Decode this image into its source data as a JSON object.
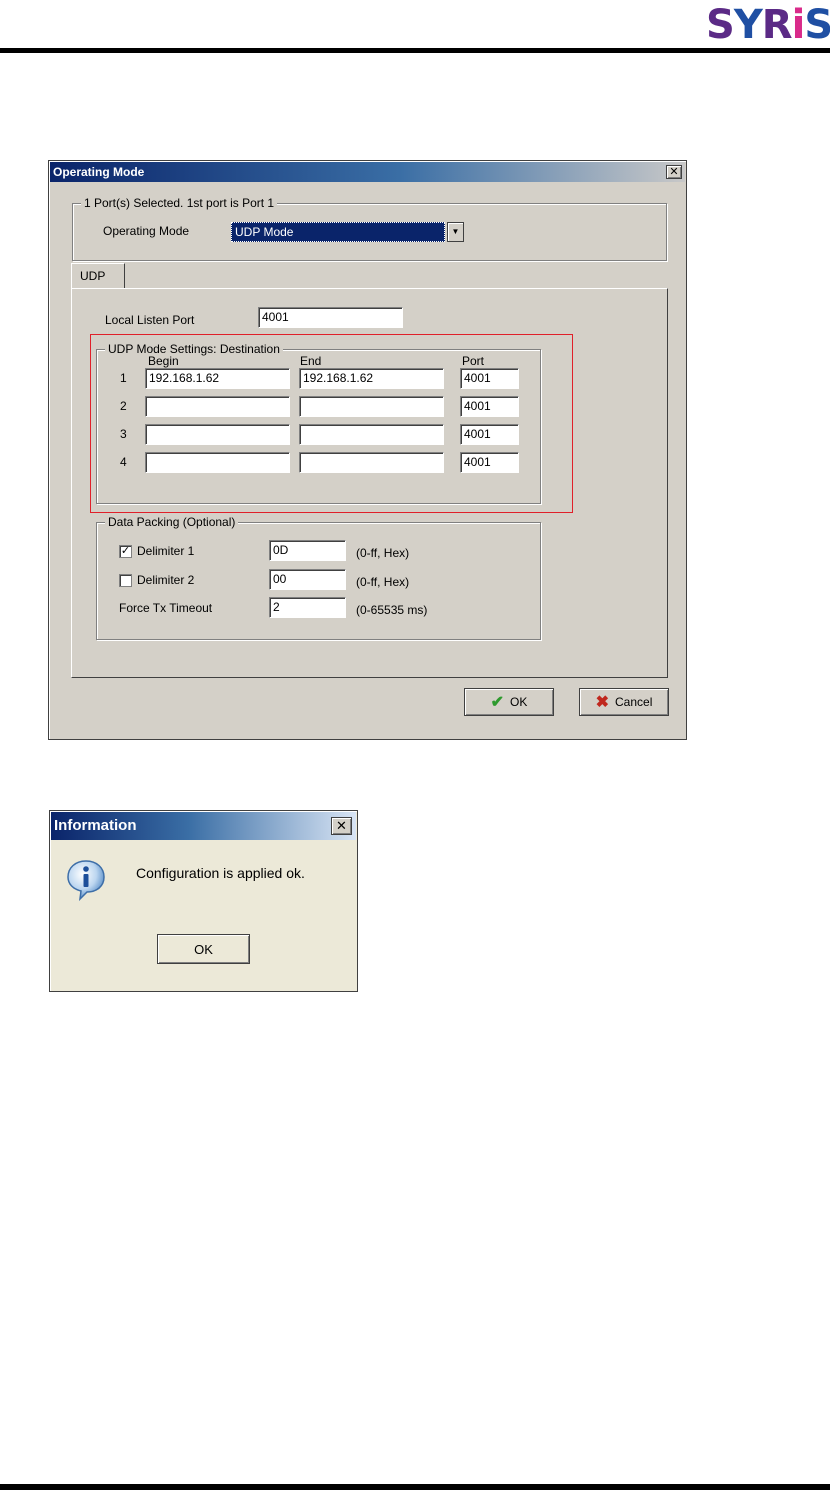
{
  "operating_mode_dialog": {
    "title": "Operating Mode",
    "selection_group": "1 Port(s) Selected. 1st port is Port 1",
    "operating_mode_label": "Operating Mode",
    "operating_mode_value": "UDP Mode",
    "tab_udp": "UDP",
    "local_listen_port_label": "Local Listen Port",
    "local_listen_port_value": "4001",
    "udp_group": {
      "title": "UDP Mode Settings: Destination",
      "header_begin": "Begin",
      "header_end": "End",
      "header_port": "Port",
      "rows": [
        {
          "num": "1",
          "begin": "192.168.1.62",
          "end": "192.168.1.62",
          "port": "4001"
        },
        {
          "num": "2",
          "begin": "",
          "end": "",
          "port": "4001"
        },
        {
          "num": "3",
          "begin": "",
          "end": "",
          "port": "4001"
        },
        {
          "num": "4",
          "begin": "",
          "end": "",
          "port": "4001"
        }
      ]
    },
    "data_packing": {
      "title": "Data Packing (Optional)",
      "delimiter1_label": "Delimiter 1",
      "delimiter1_checked": true,
      "delimiter1_value": "0D",
      "delimiter1_hint": "(0-ff, Hex)",
      "delimiter2_label": "Delimiter 2",
      "delimiter2_checked": false,
      "delimiter2_value": "00",
      "delimiter2_hint": "(0-ff, Hex)",
      "force_tx_label": "Force Tx Timeout",
      "force_tx_value": "2",
      "force_tx_hint": "(0-65535 ms)"
    },
    "ok_label": "OK",
    "cancel_label": "Cancel"
  },
  "information_dialog": {
    "title": "Information",
    "message": "Configuration is applied ok.",
    "ok_label": "OK"
  },
  "colors": {
    "highlight": "#e0202a",
    "title_gradient_start": "#0a246a",
    "title_gradient_end": "#a6caf0",
    "logo_purple": "#5b2a86",
    "logo_blue": "#1f4fa3",
    "logo_pink": "#d92a8a"
  }
}
